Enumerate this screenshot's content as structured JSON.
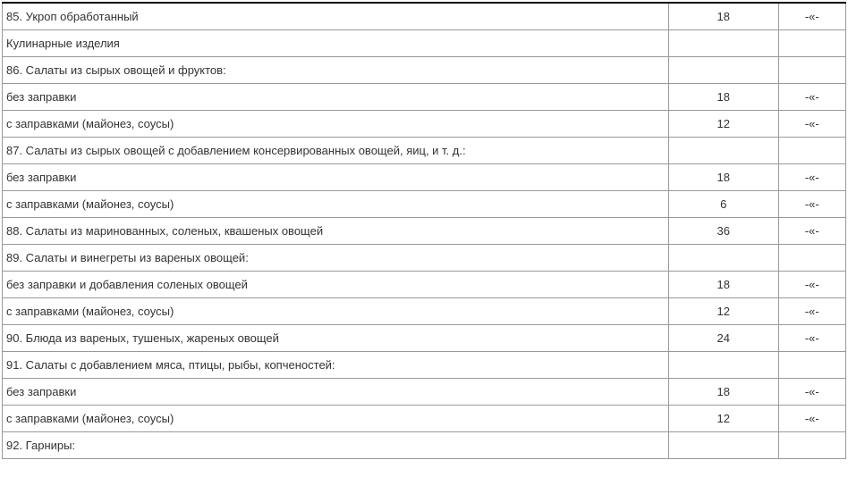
{
  "table": {
    "rows": [
      {
        "name": "85. Укроп обработанный",
        "hours": "18",
        "mark": "-«-"
      },
      {
        "name": "Кулинарные изделия",
        "hours": "",
        "mark": ""
      },
      {
        "name": "86. Салаты из сырых овощей и фруктов:",
        "hours": "",
        "mark": ""
      },
      {
        "name": "без заправки",
        "hours": "18",
        "mark": "-«-"
      },
      {
        "name": "с заправками (майонез, соусы)",
        "hours": "12",
        "mark": "-«-"
      },
      {
        "name": "87. Салаты из сырых овощей с добавлением консервированных овощей, яиц, и т. д.:",
        "hours": "",
        "mark": ""
      },
      {
        "name": "без заправки",
        "hours": "18",
        "mark": "-«-"
      },
      {
        "name": "с заправками (майонез, соусы)",
        "hours": "6",
        "mark": "-«-"
      },
      {
        "name": "88. Салаты из маринованных, соленых, квашеных овощей",
        "hours": "36",
        "mark": "-«-"
      },
      {
        "name": "89. Салаты и винегреты из вареных овощей:",
        "hours": "",
        "mark": ""
      },
      {
        "name": "без заправки и добавления соленых овощей",
        "hours": "18",
        "mark": "-«-"
      },
      {
        "name": "с заправками (майонез, соусы)",
        "hours": "12",
        "mark": "-«-"
      },
      {
        "name": "90. Блюда из вареных, тушеных, жареных овощей",
        "hours": "24",
        "mark": "-«-"
      },
      {
        "name": "91. Салаты с добавлением мяса, птицы, рыбы, копченостей:",
        "hours": "",
        "mark": ""
      },
      {
        "name": "без заправки",
        "hours": "18",
        "mark": "-«-"
      },
      {
        "name": "с заправками (майонез, соусы)",
        "hours": "12",
        "mark": "-«-"
      },
      {
        "name": "92. Гарниры:",
        "hours": "",
        "mark": ""
      }
    ]
  }
}
